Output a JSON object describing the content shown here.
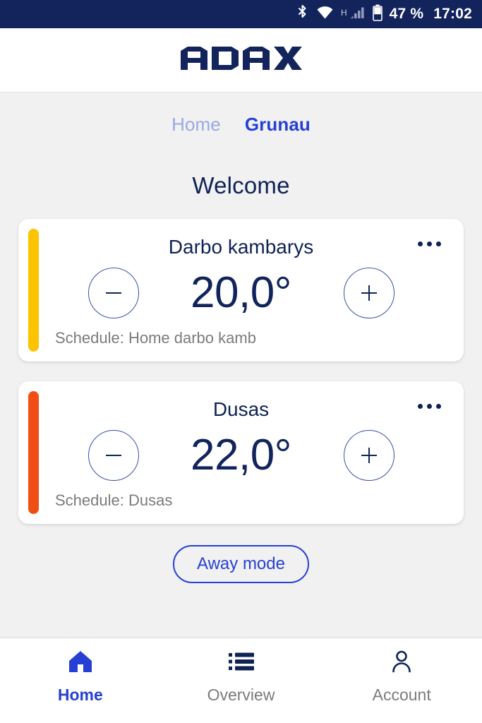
{
  "statusbar": {
    "network_type": "H",
    "battery_percent": "47 %",
    "time": "17:02",
    "icons": [
      "bluetooth-icon",
      "wifi-icon",
      "cellular-signal-icon",
      "battery-icon"
    ]
  },
  "header": {
    "brand": "ADAX",
    "brand_color": "#13245c"
  },
  "tabs": [
    {
      "label": "Home",
      "active": false
    },
    {
      "label": "Grunau",
      "active": true
    }
  ],
  "main": {
    "welcome_title": "Welcome",
    "away_button_label": "Away mode",
    "cards": [
      {
        "name": "Darbo kambarys",
        "temperature": "20,0°",
        "schedule": "Schedule: Home darbo kamb",
        "accent_color": "#fcc300",
        "decrease_label": "−",
        "increase_label": "+"
      },
      {
        "name": "Dusas",
        "temperature": "22,0°",
        "schedule": "Schedule: Dusas",
        "accent_color": "#f04e14",
        "decrease_label": "−",
        "increase_label": "+"
      }
    ]
  },
  "bottom_nav": [
    {
      "label": "Home",
      "icon": "house-icon",
      "active": true
    },
    {
      "label": "Overview",
      "icon": "list-icon",
      "active": false
    },
    {
      "label": "Account",
      "icon": "person-icon",
      "active": false
    }
  ],
  "colors": {
    "navy": "#13245c",
    "accent_blue": "#2640d4",
    "muted_blue": "#9aa9e0",
    "body_bg": "#f1f1f1",
    "muted_text": "#7b7b7b"
  }
}
